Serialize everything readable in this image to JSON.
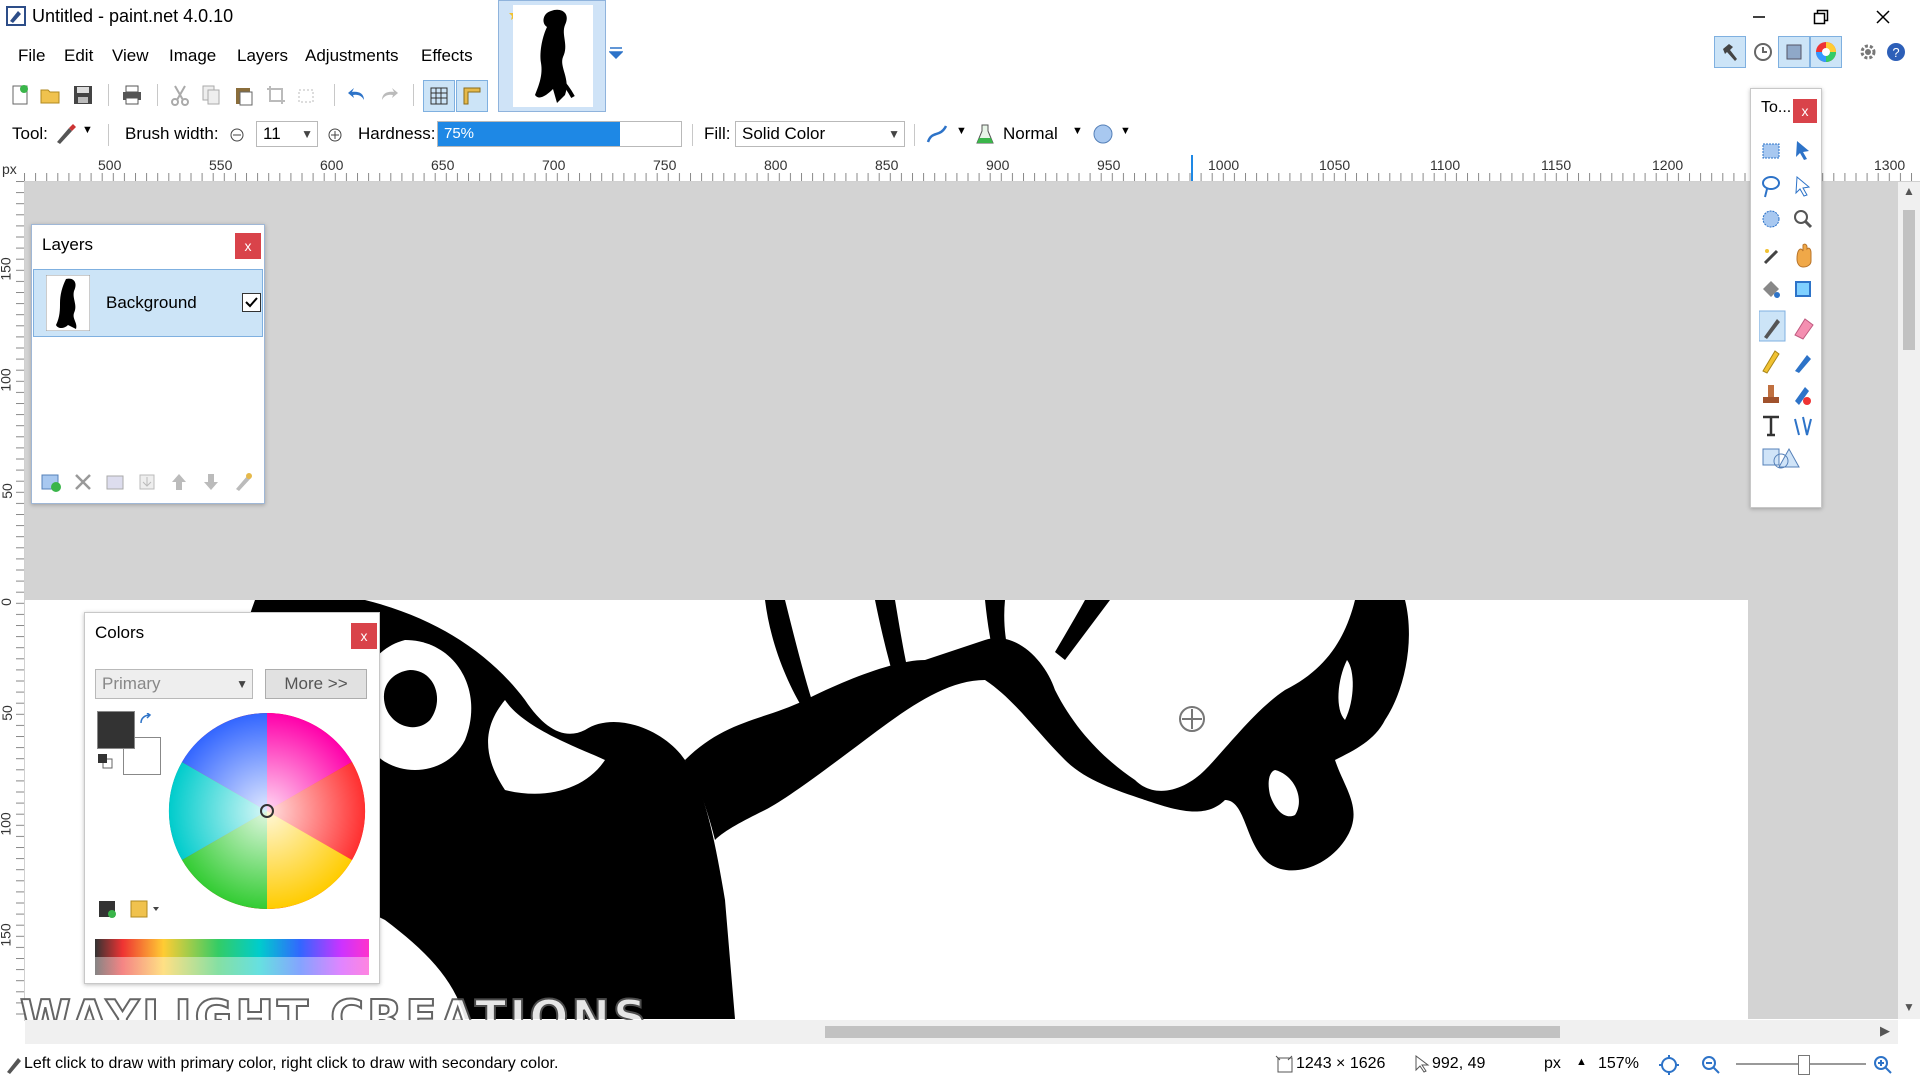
{
  "window": {
    "title": "Untitled - paint.net 4.0.10"
  },
  "menu": [
    "File",
    "Edit",
    "View",
    "Image",
    "Layers",
    "Adjustments",
    "Effects"
  ],
  "tool_options": {
    "tool_label": "Tool:",
    "brush_width_label": "Brush width:",
    "brush_width": "11",
    "hardness_label": "Hardness:",
    "hardness_value": "75%",
    "hardness_fraction": 0.75,
    "fill_label": "Fill:",
    "fill_value": "Solid Color",
    "blend_mode": "Normal"
  },
  "ruler": {
    "unit": "px",
    "h_ticks": [
      "500",
      "550",
      "600",
      "650",
      "700",
      "750",
      "800",
      "850",
      "900",
      "950",
      "1000",
      "1050",
      "1100",
      "1150",
      "1200",
      "1300"
    ],
    "v_ticks": [
      "150",
      "100",
      "50",
      "0",
      "50",
      "100",
      "150"
    ]
  },
  "layers_panel": {
    "title": "Layers",
    "close": "x",
    "layers": [
      {
        "name": "Background",
        "visible": true
      }
    ]
  },
  "tools_panel": {
    "title": "To...",
    "close": "x"
  },
  "colors_panel": {
    "title": "Colors",
    "close": "x",
    "mode": "Primary",
    "more_button": "More >>"
  },
  "watermark": "WAYLIGHT CREATIONS",
  "status": {
    "hint": "Left click to draw with primary color, right click to draw with secondary color.",
    "image_size": "1243 × 1626",
    "cursor_pos": "992, 49",
    "unit": "px",
    "zoom": "157%"
  },
  "colors": {
    "accent": "#1e88e5",
    "selection_bg": "#cce4f7",
    "close_red": "#d9434a",
    "workspace": "#d3d3d3"
  }
}
